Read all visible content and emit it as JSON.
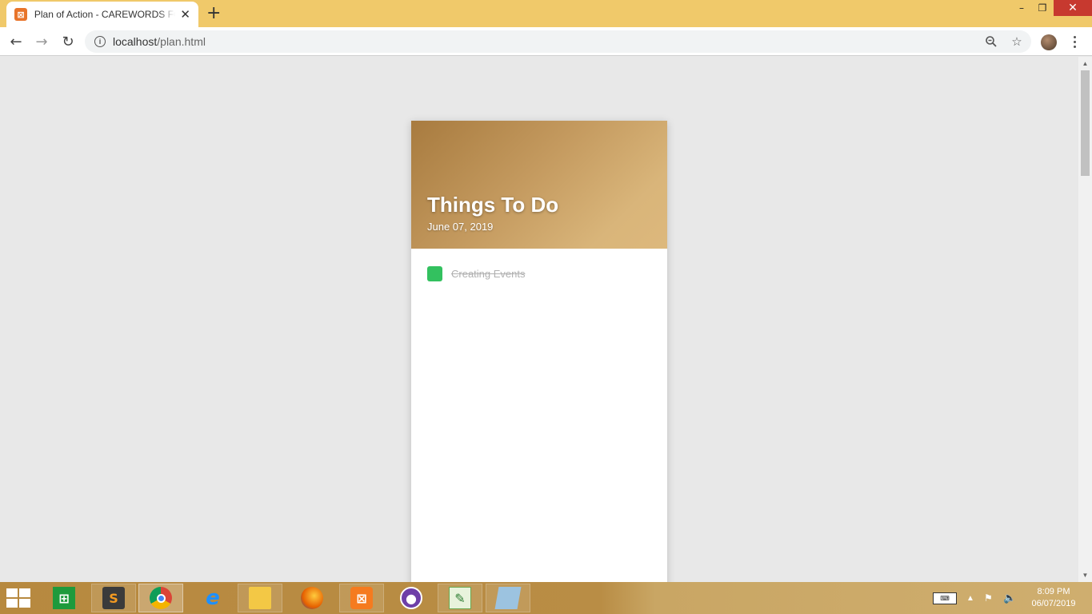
{
  "browser": {
    "tab_title": "Plan of Action - CAREWORDS FOR",
    "tab_favicon": "xampp-icon",
    "url_host": "localhost",
    "url_path": "/plan.html"
  },
  "card": {
    "title": "Things To Do",
    "date": "June 07, 2019",
    "todos": [
      {
        "label": "Creating Events",
        "done": true
      }
    ]
  },
  "taskbar": {
    "apps": [
      "windows-store",
      "sublime-text",
      "chrome",
      "internet-explorer",
      "file-explorer",
      "firefox",
      "xampp",
      "github-desktop",
      "notepad-plus-plus",
      "sticky-notes"
    ],
    "clock_time": "8:09 PM",
    "clock_date": "06/07/2019"
  },
  "colors": {
    "titlebar": "#f0c96a",
    "header_gradient_start": "#a87b3f",
    "header_gradient_end": "#ddb87c",
    "todo_check": "#33c15f",
    "page_background": "#e8e8e8"
  }
}
